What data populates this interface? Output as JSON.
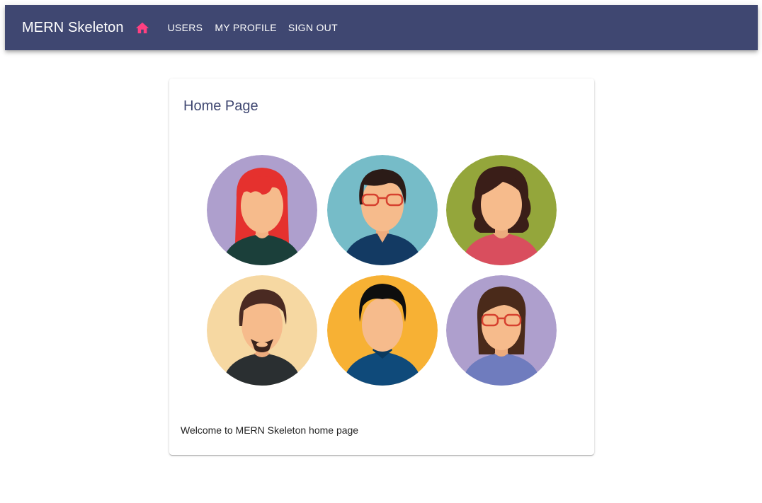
{
  "appbar": {
    "title": "MERN Skeleton",
    "home_icon": "home-icon",
    "nav": [
      {
        "label": "USERS"
      },
      {
        "label": "MY PROFILE"
      },
      {
        "label": "SIGN OUT"
      }
    ],
    "colors": {
      "background": "#3f4771",
      "home_icon": "#ff4081"
    }
  },
  "card": {
    "title": "Home Page",
    "image_icons": [
      "avatar-red-hair-woman",
      "avatar-glasses-man",
      "avatar-curly-hair-woman",
      "avatar-goatee-man",
      "avatar-black-hair-man",
      "avatar-glasses-woman"
    ],
    "body_text": "Welcome to MERN Skeleton home page"
  }
}
